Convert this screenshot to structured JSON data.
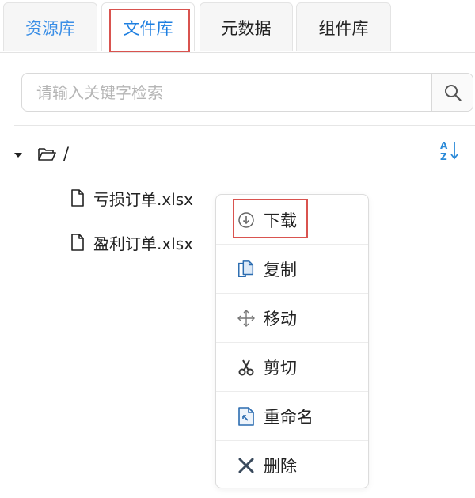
{
  "tabs": [
    {
      "label": "资源库"
    },
    {
      "label": "文件库"
    },
    {
      "label": "元数据"
    },
    {
      "label": "组件库"
    }
  ],
  "active_tab": "文件库",
  "search": {
    "placeholder": "请输入关键字检索",
    "value": ""
  },
  "tree": {
    "root_label": "/",
    "expanded": true,
    "files": [
      {
        "name": "亏损订单.xlsx"
      },
      {
        "name": "盈利订单.xlsx"
      }
    ]
  },
  "context_menu": {
    "items": [
      {
        "label": "下载",
        "icon": "download-icon"
      },
      {
        "label": "复制",
        "icon": "copy-icon"
      },
      {
        "label": "移动",
        "icon": "move-icon"
      },
      {
        "label": "剪切",
        "icon": "cut-icon"
      },
      {
        "label": "重命名",
        "icon": "rename-icon"
      },
      {
        "label": "删除",
        "icon": "delete-icon"
      }
    ]
  },
  "colors": {
    "accent": "#1e7fe0",
    "highlight_box": "#d9534f",
    "icon_blue": "#2b6cb0"
  }
}
